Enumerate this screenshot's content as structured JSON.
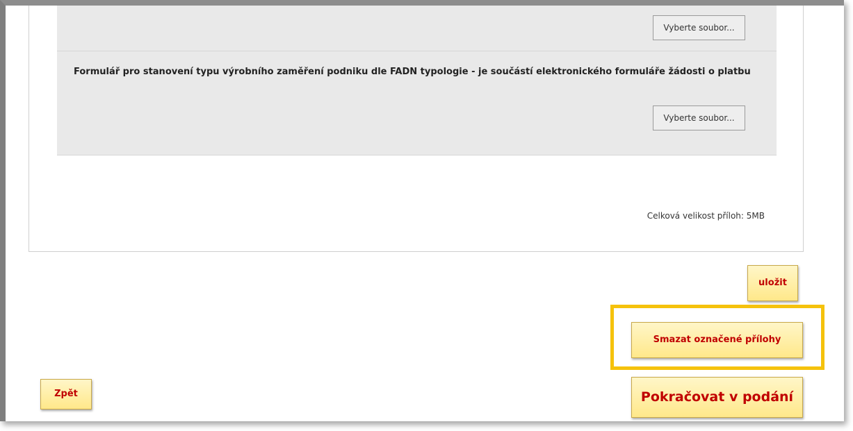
{
  "attachments": {
    "rows": [
      {
        "title": "",
        "file_button_label": "Vyberte soubor..."
      },
      {
        "title": "Formulář pro stanovení typu výrobního zaměření podniku dle FADN typologie - je součástí elektronického formuláře žádosti o platbu",
        "file_button_label": "Vyberte soubor..."
      }
    ],
    "total_size_label": "Celková velikost příloh: 5MB"
  },
  "actions": {
    "save_label": "uložit",
    "delete_selected_label": "Smazat označené přílohy",
    "continue_label": "Pokračovat v podání",
    "back_label": "Zpět"
  },
  "colors": {
    "button_text": "#c00000",
    "button_bg": "#ffe88a",
    "highlight": "#f5c20c",
    "panel_bg": "#e9e9e9"
  }
}
